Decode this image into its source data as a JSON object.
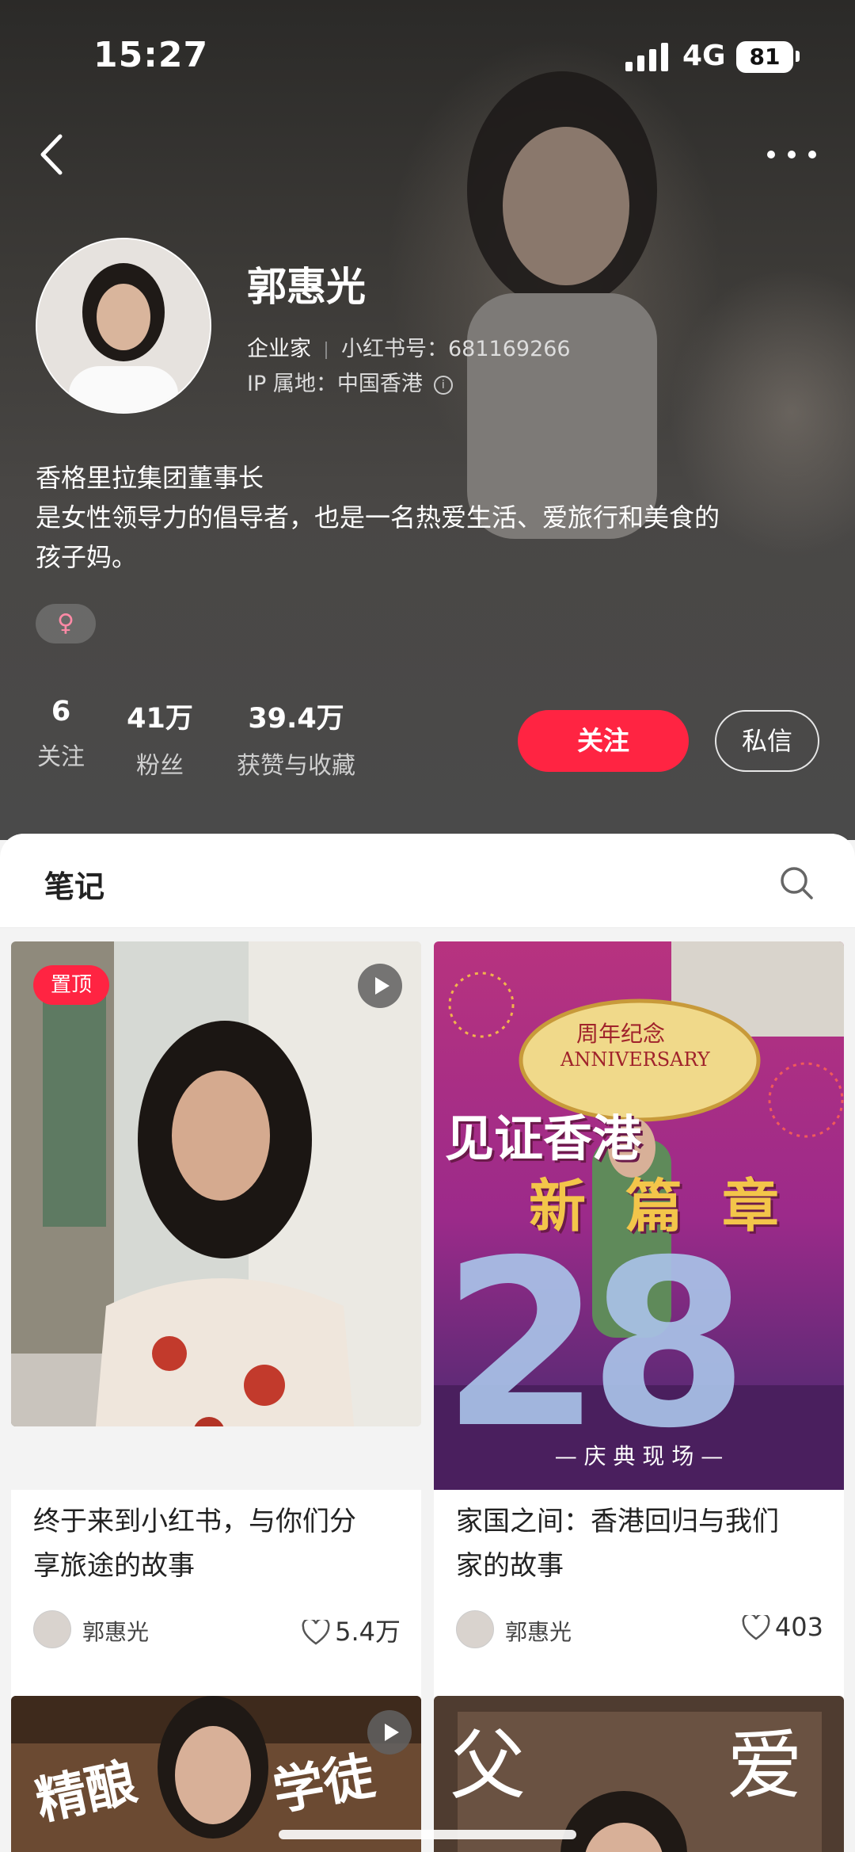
{
  "status_bar": {
    "time": "15:27",
    "network": "4G",
    "battery": "81"
  },
  "profile": {
    "name": "郭惠光",
    "occupation": "企业家",
    "id_label": "小红书号：681169266",
    "ip_location": "IP 属地：中国香港",
    "bio_lines": [
      "香格里拉集团董事长",
      "是女性领导力的倡导者，也是一名热爱生活、爱旅行和美食的",
      "孩子妈。"
    ],
    "gender_symbol": "♀"
  },
  "stats": [
    {
      "value": "6",
      "label": "关注"
    },
    {
      "value": "41万",
      "label": "粉丝"
    },
    {
      "value": "39.4万",
      "label": "获赞与收藏"
    }
  ],
  "actions": {
    "follow": "关注",
    "message": "私信"
  },
  "notes": {
    "tab_title": "笔记",
    "cards": [
      {
        "pin_label": "置顶",
        "title_lines": [
          "终于来到小红书，与你们分",
          "享旅途的故事"
        ],
        "author": "郭惠光",
        "likes": "5.4万"
      },
      {
        "image_text": {
          "line1": "见证香港",
          "line2": "新篇章",
          "big_number": "28",
          "anniversary_cn": "周年纪念",
          "anniversary_en": "ANNIVERSARY",
          "bottom": "— 庆 典 现 场 —"
        },
        "title_lines": [
          "家国之间：香港回归与我们",
          "家的故事"
        ],
        "author": "郭惠光",
        "likes": "403"
      },
      {
        "image_text": {
          "left": "精酿",
          "right": "学徒"
        }
      },
      {
        "image_text": {
          "left": "父",
          "right": "爱"
        }
      }
    ]
  },
  "colors": {
    "accent": "#ff2442",
    "header_bg": "#3d3b38"
  }
}
